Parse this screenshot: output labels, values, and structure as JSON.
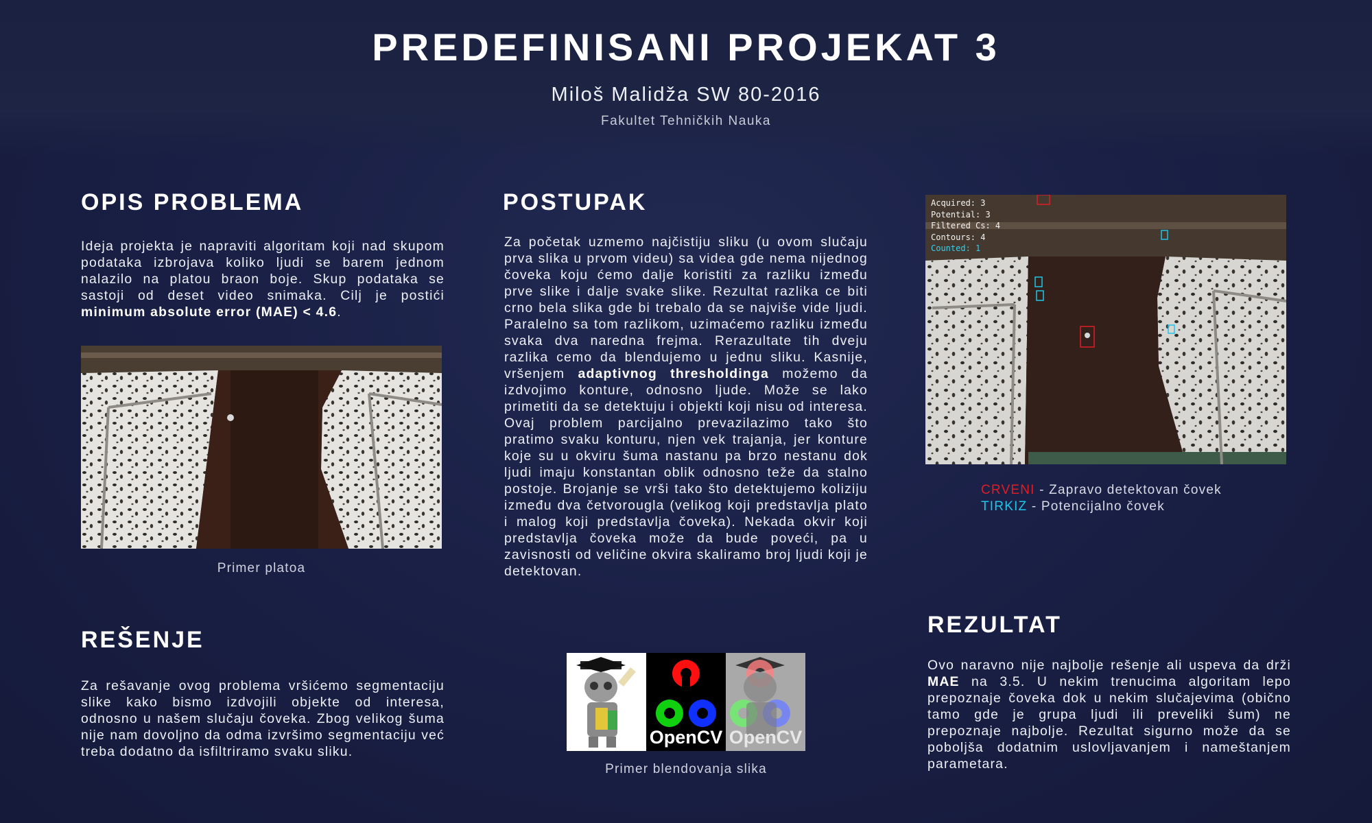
{
  "header": {
    "title": "PREDEFINISANI PROJEKAT 3",
    "author": "Miloš Malidža SW 80-2016",
    "faculty": "Fakultet Tehničkih Nauka"
  },
  "opis": {
    "heading": "OPIS PROBLEMA",
    "text": "Ideja projekta je napraviti algoritam koji nad skupom podataka izbrojava koliko ljudi se barem jednom nalazilo na platou braon boje. Skup podataka se sastoji od deset video snimaka. Cilj je postići",
    "text_bold": "minimum absolute error (MAE) < 4.6",
    "text_end": ".",
    "caption": "Primer platoa"
  },
  "postupak": {
    "heading": "POSTUPAK",
    "text_a": "Za početak uzmemo najčistiju sliku (u ovom slučaju prva slika u prvom videu)  sa videa gde nema nijednog čoveka koju ćemo dalje koristiti za razliku između prve slike i dalje svake slike. Rezultat razlika ce biti crno bela slika gde bi trebalo da se najviše vide ljudi. Paralelno sa tom razlikom, uzimaćemo razliku između svaka dva naredna frejma. Rerazultate tih dveju razlika cemo da blendujemo u jednu sliku. Kasnije, vršenjem",
    "text_bold": "adaptivnog thresholdinga",
    "text_b": "možemo da izdvojimo konture, odnosno ljude. Može se lako primetiti da se detektuju i objekti koji nisu od interesa. Ovaj problem parcijalno prevazilazimo tako što pratimo svaku konturu, njen vek trajanja, jer konture koje su u okviru šuma nastanu pa brzo nestanu dok ljudi imaju konstantan oblik odnosno teže da stalno postoje. Brojanje se vrši tako što detektujemo koliziju između dva četvorougla (velikog koji predstavlja plato i malog koji predstavlja čoveka). Nekada okvir koji predstavlja čoveka može da bude poveći, pa u zavisnosti od veličine okvira skaliramo broj ljudi koji je detektovan."
  },
  "detection": {
    "overlay": {
      "acquired": "Acquired: 3",
      "potential": "Potential: 3",
      "filtered": "Filtered Cs: 4",
      "contours": "Contours: 4",
      "counted": "Counted: 1"
    },
    "legend": [
      {
        "key": "CRVENI",
        "text": " - Zapravo detektovan čovek",
        "color": "#e01d24"
      },
      {
        "key": "TIRKIZ",
        "text": " - Potencijalno čovek",
        "color": "#1fc6e8"
      }
    ]
  },
  "resenje": {
    "heading": "REŠENJE",
    "text": "Za rešavanje ovog problema vršićemo segmentaciju slike kako bismo izdvojili objekte od interesa, odnosno u našem slučaju čoveka. Zbog velikog šuma nije nam dovoljno da odma izvršimo segmentaciju već treba dodatno da isfiltriramo svaku sliku."
  },
  "blend": {
    "logo_text": "OpenCV",
    "caption": "Primer blendovanja slika"
  },
  "rezultat": {
    "heading": "REZULTAT",
    "text_a": "Ovo naravno nije najbolje rešenje ali uspeva da drži",
    "text_bold": "MAE",
    "text_b": "na 3.5. U nekim trenucima algoritam lepo prepoznaje čoveka dok u nekim slučajevima (obično tamo gde je grupa ljudi ili preveliki šum) ne prepoznaje najbolje. Rezultat sigurno može da se poboljša dodatnim uslovljavanjem i nameštanjem parametara."
  },
  "colors": {
    "background": "#1a2046",
    "red_label": "#e01d24",
    "cyan_label": "#1fc6e8"
  }
}
